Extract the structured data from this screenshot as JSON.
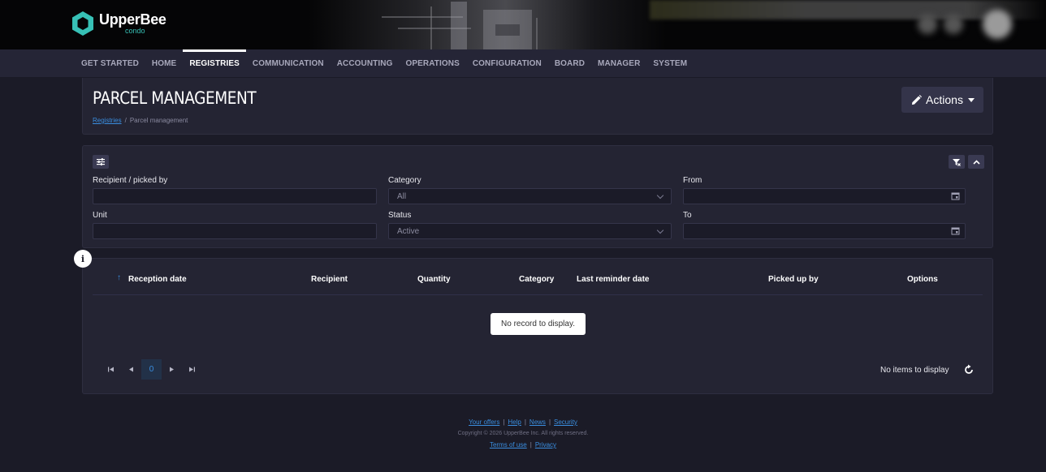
{
  "header": {
    "brand_name": "UpperBee",
    "brand_sub": "condo"
  },
  "nav": {
    "items": [
      {
        "label": "GET STARTED"
      },
      {
        "label": "HOME"
      },
      {
        "label": "REGISTRIES",
        "active": true
      },
      {
        "label": "COMMUNICATION"
      },
      {
        "label": "ACCOUNTING"
      },
      {
        "label": "OPERATIONS"
      },
      {
        "label": "CONFIGURATION"
      },
      {
        "label": "BOARD"
      },
      {
        "label": "MANAGER"
      },
      {
        "label": "SYSTEM"
      }
    ]
  },
  "page": {
    "title": "PARCEL MANAGEMENT",
    "breadcrumb": {
      "root": "Registries",
      "separator": "/",
      "current": "Parcel management"
    },
    "actions_label": "Actions"
  },
  "filters": {
    "recipient_label": "Recipient / picked by",
    "recipient_value": "",
    "category_label": "Category",
    "category_value": "All",
    "from_label": "From",
    "from_value": "",
    "unit_label": "Unit",
    "unit_value": "",
    "status_label": "Status",
    "status_value": "Active",
    "to_label": "To",
    "to_value": ""
  },
  "grid": {
    "info_icon": "i",
    "columns": [
      "Reception date",
      "Recipient",
      "Quantity",
      "Category",
      "Last reminder date",
      "Picked up by",
      "Options"
    ],
    "sort_indicator": "↑",
    "empty_message": "No record to display.",
    "pager": {
      "current_page": "0",
      "status_text": "No items to display"
    }
  },
  "footer": {
    "links": [
      "Your offers",
      "Help",
      "News",
      "Security"
    ],
    "copyright": "Copyright © 2026 UpperBee Inc. All rights reserved.",
    "legal": [
      "Terms of use",
      "Privacy"
    ]
  },
  "colors": {
    "accent": "#3a8ee0",
    "brand": "#37c1b6",
    "background": "#1b1b27",
    "panel": "#242433"
  }
}
